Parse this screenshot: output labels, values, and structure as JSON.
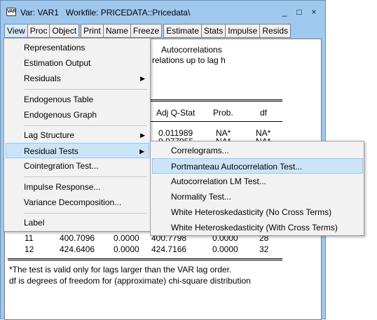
{
  "window": {
    "icon_text": "VAR",
    "title": "Var: VAR1   Workfile: PRICEDATA::Pricedata\\",
    "minimize_glyph": "_",
    "maximize_glyph": "□",
    "close_glyph": "×"
  },
  "toolbar": {
    "view": "View",
    "proc": "Proc",
    "object": "Object",
    "print": "Print",
    "name": "Name",
    "freeze": "Freeze",
    "estimate": "Estimate",
    "stats": "Stats",
    "impulse": "Impulse",
    "resids": "Resids"
  },
  "output": {
    "title_line1": "Autocorrelations",
    "title_line2": "relations up to lag h",
    "col_adj_q": "Adj Q-Stat",
    "col_prob": "Prob.",
    "col_df": "df",
    "row1": {
      "adj_q": "0.011989",
      "prob": "NA*",
      "df": "NA*"
    },
    "row2_partial": {
      "adj_q": "0.077955",
      "prob": "NA*",
      "df": "NA*"
    },
    "row11": {
      "lag": "11",
      "q": "400.7096",
      "prob": "0.0000",
      "adj_q": "400.7798",
      "adj_prob": "0.0000",
      "df": "28"
    },
    "row12": {
      "lag": "12",
      "q": "424.6406",
      "prob": "0.0000",
      "adj_q": "424.7166",
      "adj_prob": "0.0000",
      "df": "32"
    },
    "footnote1": "*The test is valid only for lags larger than the VAR lag order.",
    "footnote2": "df is degrees of freedom for (approximate) chi-square distribution"
  },
  "view_menu": {
    "representations": "Representations",
    "estimation_output": "Estimation Output",
    "residuals": "Residuals",
    "endogenous_table": "Endogenous Table",
    "endogenous_graph": "Endogenous Graph",
    "lag_structure": "Lag Structure",
    "residual_tests": "Residual Tests",
    "cointegration_test": "Cointegration Test...",
    "impulse_response": "Impulse Response...",
    "variance_decomposition": "Variance Decomposition...",
    "label": "Label",
    "submenu_arrow": "▶"
  },
  "residual_tests_menu": {
    "correlograms": "Correlograms...",
    "portmanteau": "Portmanteau Autocorrelation Test...",
    "autocorrelation_lm": "Autocorrelation LM Test...",
    "normality": "Normality Test...",
    "white_no_cross": "White Heteroskedasticity (No Cross Terms)",
    "white_cross": "White Heteroskedasticity (With Cross Terms)"
  }
}
